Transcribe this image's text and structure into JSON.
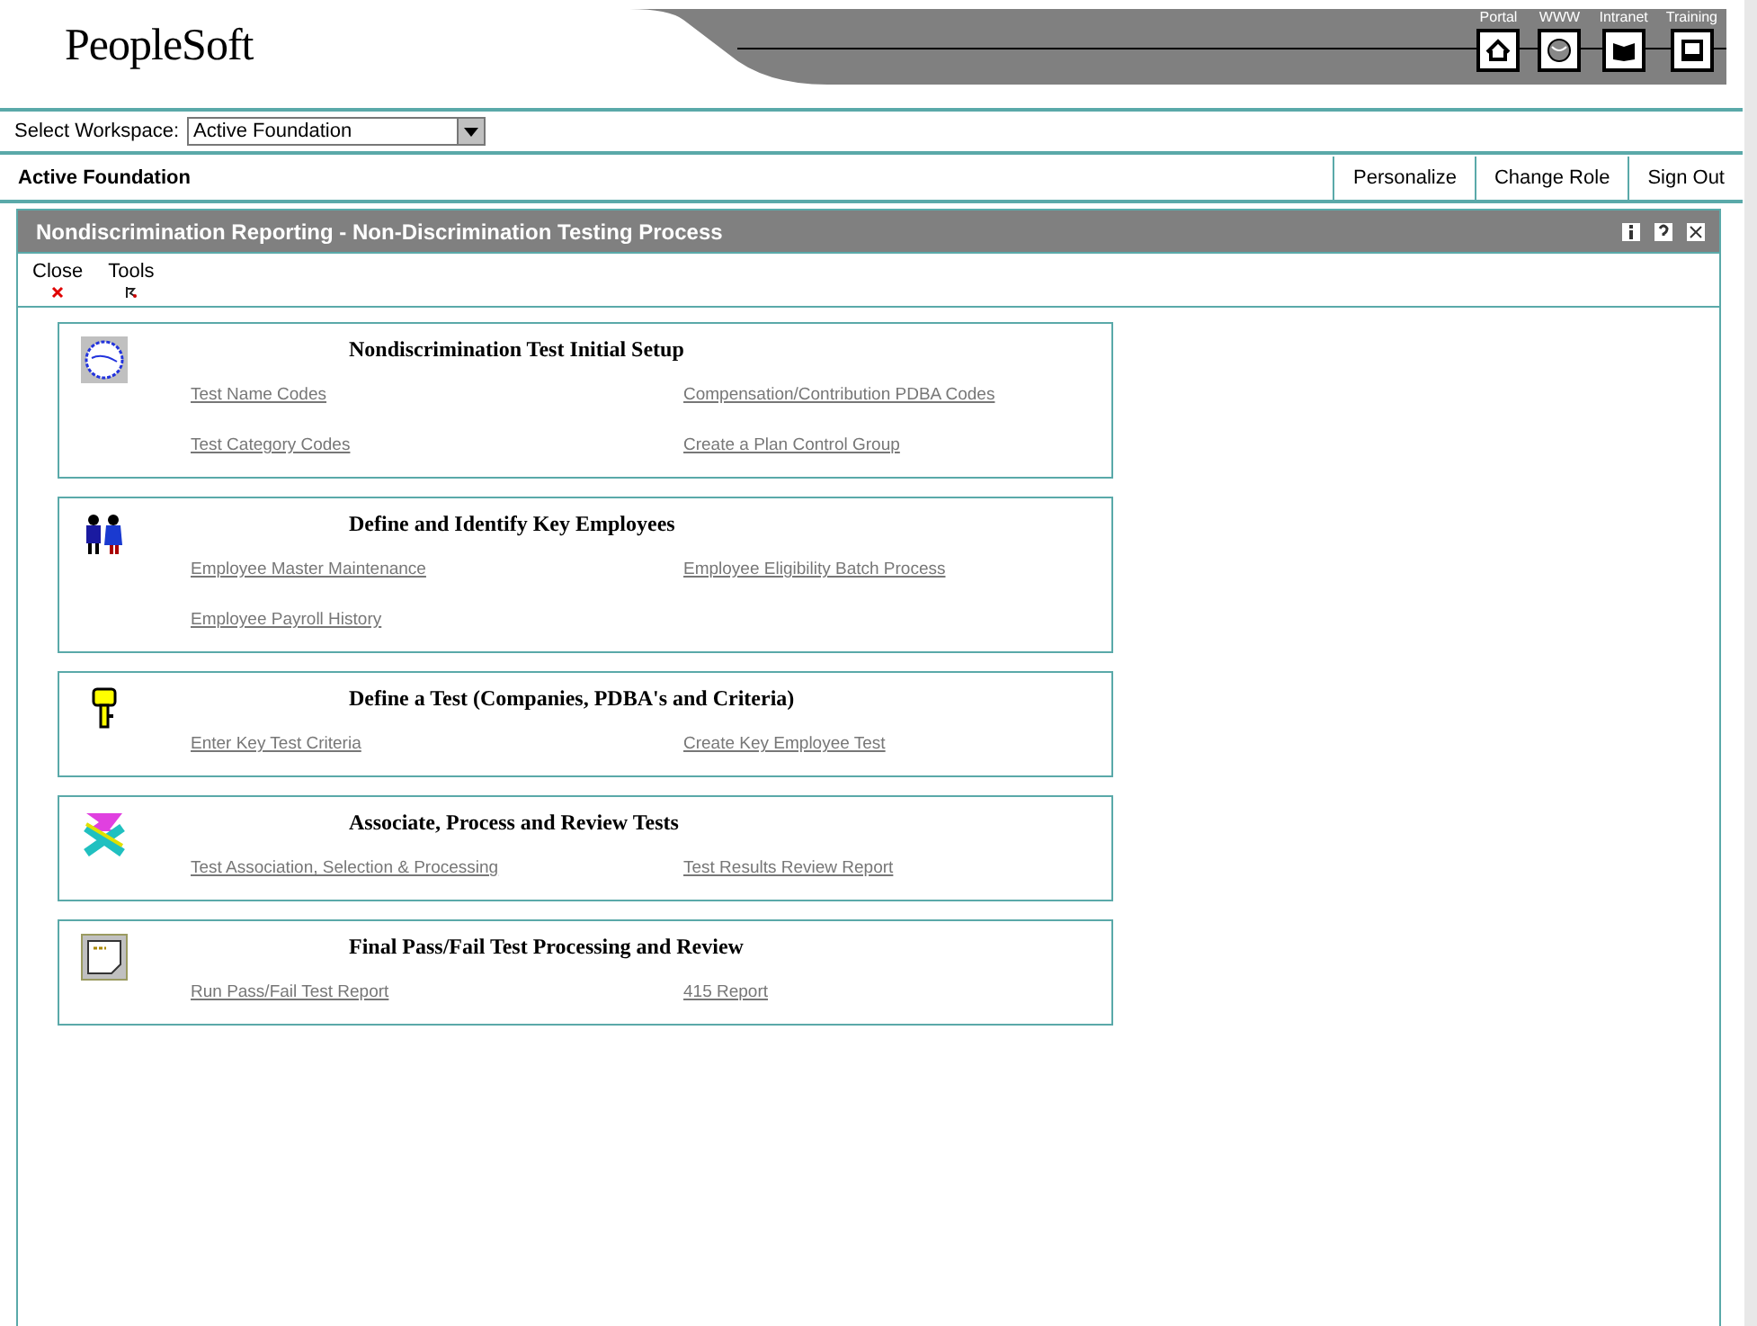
{
  "header": {
    "logo": "PeopleSoft",
    "nav": [
      {
        "label": "Portal",
        "kind": "home"
      },
      {
        "label": "WWW",
        "kind": "globe"
      },
      {
        "label": "Intranet",
        "kind": "book"
      },
      {
        "label": "Training",
        "kind": "monitor"
      }
    ]
  },
  "workspace": {
    "label": "Select Workspace:",
    "value": "Active Foundation"
  },
  "role_bar": {
    "title": "Active Foundation",
    "actions": [
      "Personalize",
      "Change Role",
      "Sign Out"
    ]
  },
  "panel": {
    "title": "Nondiscrimination Reporting - Non-Discrimination Testing Process",
    "tools": [
      {
        "label": "Close",
        "kind": "close"
      },
      {
        "label": "Tools",
        "kind": "tools"
      }
    ],
    "sections": [
      {
        "title": "Nondiscrimination Test Initial Setup",
        "kind": "globe",
        "links": [
          "Test Name Codes",
          "Compensation/Contribution PDBA Codes",
          "Test Category Codes",
          "Create a Plan Control Group"
        ]
      },
      {
        "title": "Define and Identify Key Employees",
        "kind": "people",
        "links": [
          "Employee Master Maintenance",
          "Employee Eligibility Batch Process",
          "Employee Payroll History"
        ]
      },
      {
        "title": "Define a Test (Companies, PDBA's and Criteria)",
        "kind": "key",
        "links": [
          "Enter Key Test Criteria",
          "Create Key Employee Test"
        ]
      },
      {
        "title": "Associate, Process and Review Tests",
        "kind": "cross",
        "links": [
          "Test Association, Selection & Processing",
          "Test Results Review Report"
        ]
      },
      {
        "title": "Final Pass/Fail Test Processing and Review",
        "kind": "note",
        "links": [
          "Run Pass/Fail Test Report",
          "415 Report"
        ]
      }
    ]
  }
}
